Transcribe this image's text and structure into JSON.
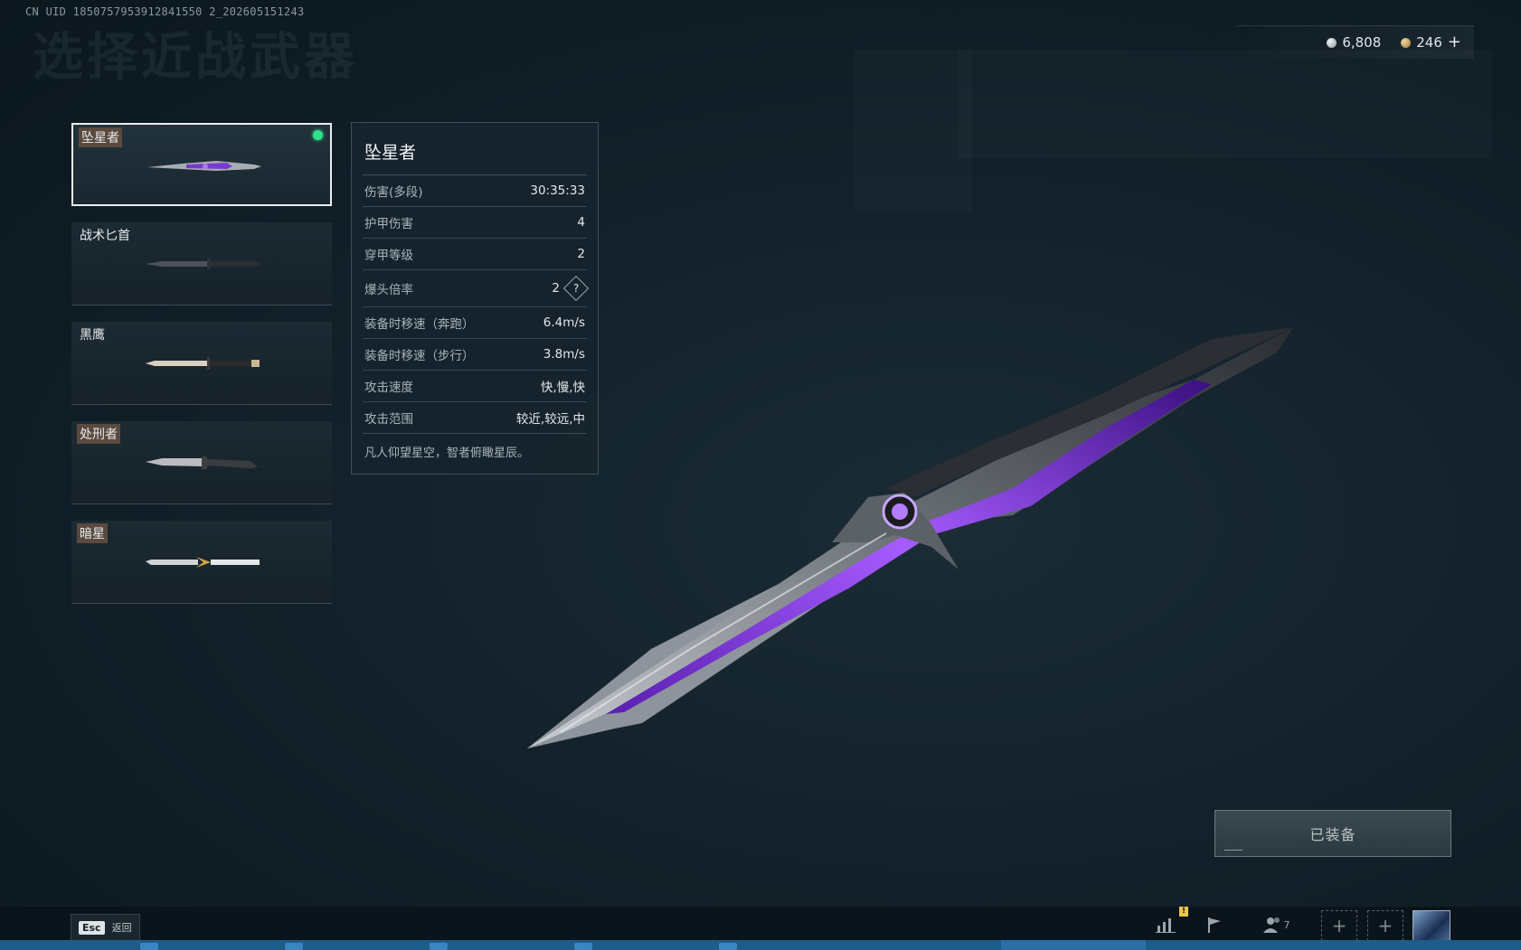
{
  "header": {
    "uid_text": "CN UID 1850757953912841550 2_202605151243",
    "page_title": "选择近战武器"
  },
  "currency": {
    "silver_amount": "6,808",
    "gold_amount": "246",
    "add_label": "+"
  },
  "weapons": [
    {
      "name": "坠星者",
      "tagged": true,
      "selected": true,
      "equipped": true
    },
    {
      "name": "战术匕首",
      "tagged": false,
      "selected": false,
      "equipped": false
    },
    {
      "name": "黑鹰",
      "tagged": false,
      "selected": false,
      "equipped": false
    },
    {
      "name": "处刑者",
      "tagged": true,
      "selected": false,
      "equipped": false
    },
    {
      "name": "暗星",
      "tagged": true,
      "selected": false,
      "equipped": false
    }
  ],
  "detail": {
    "title": "坠星者",
    "stats": [
      {
        "label": "伤害(多段)",
        "value": "30:35:33"
      },
      {
        "label": "护甲伤害",
        "value": "4"
      },
      {
        "label": "穿甲等级",
        "value": "2"
      },
      {
        "label": "爆头倍率",
        "value": "2",
        "help": "?"
      },
      {
        "label": "装备时移速（奔跑）",
        "value": "6.4m/s"
      },
      {
        "label": "装备时移速（步行）",
        "value": "3.8m/s"
      },
      {
        "label": "攻击速度",
        "value": "快,慢,快"
      },
      {
        "label": "攻击范围",
        "value": "较近,较远,中"
      }
    ],
    "description": "凡人仰望星空，智者俯瞰星辰。"
  },
  "equip_button": {
    "label": "已装备"
  },
  "bottom_bar": {
    "esc_key": "Esc",
    "back_label": "返回",
    "notify_badge": "!",
    "friends_count": "7",
    "slot_plus": "+"
  },
  "colors": {
    "accent_purple": "#8a3cf0",
    "equipped_dot": "#2fe38a",
    "tag_bg": "#5a4a3e"
  }
}
